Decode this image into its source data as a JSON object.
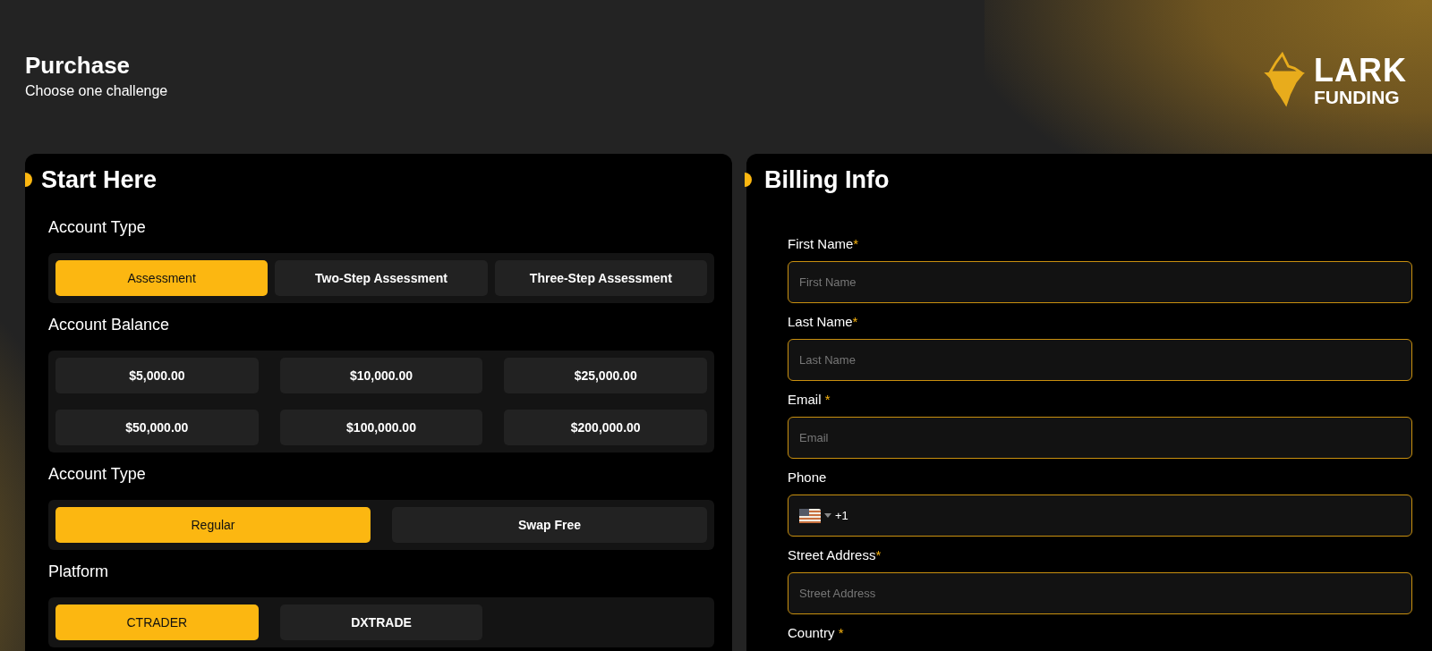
{
  "header": {
    "title": "Purchase",
    "subtitle": "Choose one challenge",
    "logo": {
      "line_1": "LARK",
      "line_2": "FUNDING"
    }
  },
  "start_panel": {
    "title": "Start Here",
    "sections": [
      {
        "title": "Account Type",
        "kind": "tabs",
        "options": [
          {
            "label": "Assessment",
            "selected": true
          },
          {
            "label": "Two-Step Assessment",
            "selected": false
          },
          {
            "label": "Three-Step Assessment",
            "selected": false
          }
        ]
      },
      {
        "title": "Account Balance",
        "kind": "grid",
        "options": [
          {
            "label": "$5,000.00",
            "selected": false
          },
          {
            "label": "$10,000.00",
            "selected": false
          },
          {
            "label": "$25,000.00",
            "selected": false
          },
          {
            "label": "$50,000.00",
            "selected": false
          },
          {
            "label": "$100,000.00",
            "selected": false
          },
          {
            "label": "$200,000.00",
            "selected": false
          }
        ]
      },
      {
        "title": "Account Type",
        "kind": "pair",
        "options": [
          {
            "label": "Regular",
            "selected": true
          },
          {
            "label": "Swap Free",
            "selected": false
          }
        ]
      },
      {
        "title": "Platform",
        "kind": "grid",
        "options": [
          {
            "label": "CTRADER",
            "selected": true
          },
          {
            "label": "DXTRADE",
            "selected": false
          }
        ]
      }
    ]
  },
  "billing_panel": {
    "title": "Billing Info",
    "fields": [
      {
        "kind": "text",
        "label": "First Name",
        "marker": "*",
        "placeholder": "First Name"
      },
      {
        "kind": "text",
        "label": "Last Name",
        "marker": "*",
        "placeholder": "Last Name"
      },
      {
        "kind": "text",
        "label": "Email",
        "marker": " *",
        "placeholder": "Email"
      },
      {
        "kind": "phone",
        "label": "Phone",
        "value": "+1"
      },
      {
        "kind": "text",
        "label": "Street Address",
        "marker": "*",
        "placeholder": "Street Address"
      },
      {
        "kind": "label",
        "label": "Country",
        "marker": " *"
      }
    ]
  }
}
